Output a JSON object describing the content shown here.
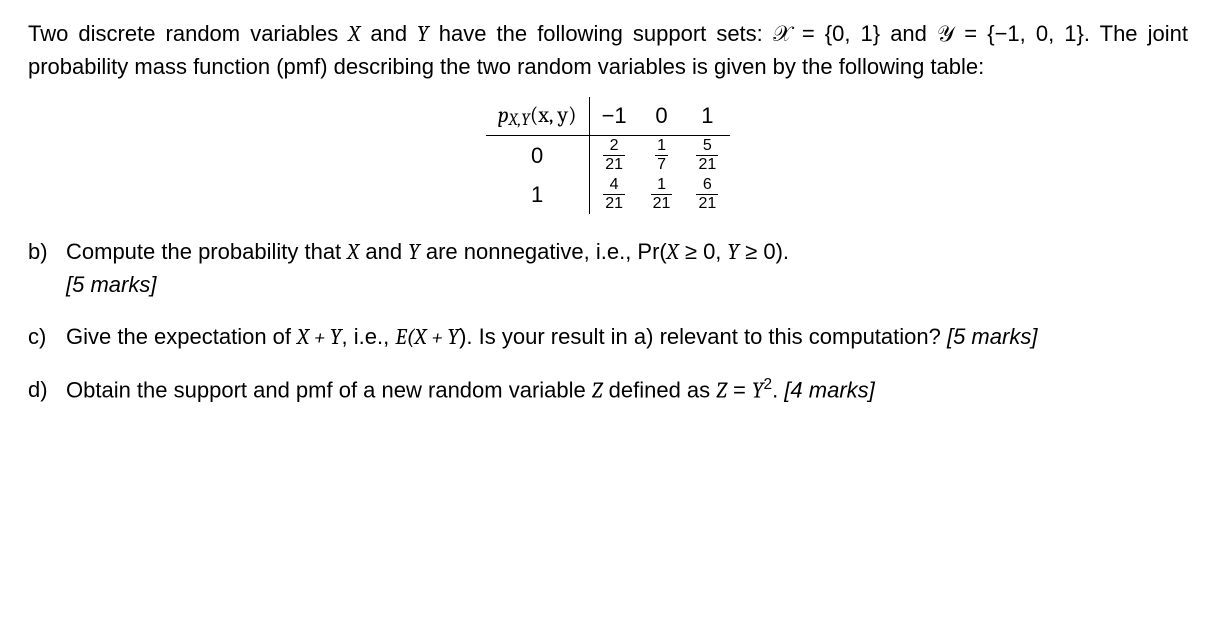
{
  "intro": {
    "text_a": "Two discrete random variables ",
    "Xv": "X",
    "text_b": " and ",
    "Yv": "Y",
    "text_c": " have the following support sets: ",
    "calX": "𝒳",
    "text_d": " = {0, 1} and ",
    "calY": "𝒴",
    "text_e": " = {−1, 0, 1}. The joint probability mass function (pmf) describing the two random variables is given by the following table:"
  },
  "table": {
    "header_fn": "p",
    "header_sub": "X,Y",
    "header_args": "(x, y)",
    "cols": [
      "−1",
      "0",
      "1"
    ],
    "rows": [
      {
        "label": "0",
        "cells": [
          {
            "n": "2",
            "d": "21"
          },
          {
            "n": "1",
            "d": "7"
          },
          {
            "n": "5",
            "d": "21"
          }
        ]
      },
      {
        "label": "1",
        "cells": [
          {
            "n": "4",
            "d": "21"
          },
          {
            "n": "1",
            "d": "21"
          },
          {
            "n": "6",
            "d": "21"
          }
        ]
      }
    ]
  },
  "questions": {
    "b": {
      "label": "b)",
      "t1": "Compute the probability that ",
      "Xv": "X",
      "t2": " and ",
      "Yv": "Y",
      "t3": " are nonnegative, i.e., Pr(",
      "expr_a": "X",
      "geq": " ≥ 0, ",
      "expr_b": "Y",
      "geq2": " ≥ 0).",
      "marks": "[5 marks]"
    },
    "c": {
      "label": "c)",
      "t1": "Give the expectation of ",
      "expr1": "X + Y",
      "t2": ", i.e., ",
      "Eopen": "E(",
      "expr2": "X + Y",
      "Eclose": ")",
      "t3": ". Is your result in a) relevant to this computation?   ",
      "marks": "[5 marks]"
    },
    "d": {
      "label": "d)",
      "t1": "Obtain the support and pmf of a new random variable ",
      "Zv": "Z",
      "t2": " defined as ",
      "Zeq": "Z",
      "eq": " = ",
      "Yv": "Y",
      "sq": "2",
      "t3": ".  ",
      "marks": "[4 marks]"
    }
  }
}
